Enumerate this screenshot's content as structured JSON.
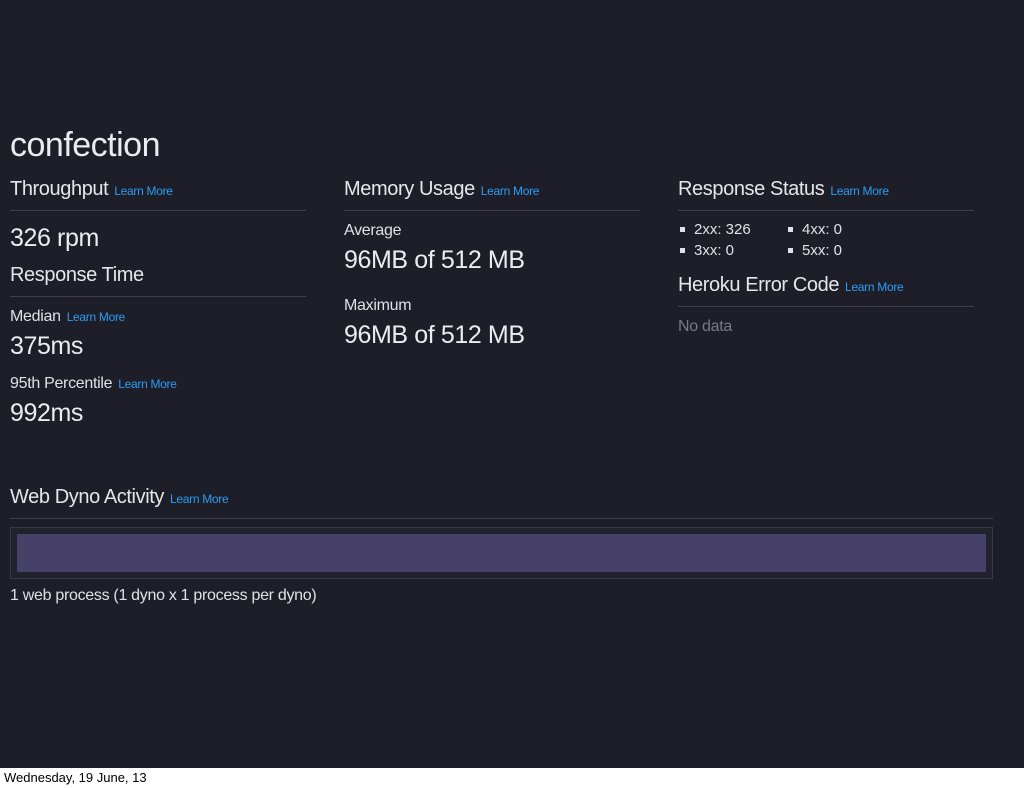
{
  "app": {
    "title": "confection"
  },
  "learn_more": "Learn More",
  "throughput": {
    "title": "Throughput",
    "value": "326 rpm"
  },
  "response_time": {
    "title": "Response Time",
    "median_label": "Median",
    "median_value": "375ms",
    "p95_label": "95th Percentile",
    "p95_value": "992ms"
  },
  "memory": {
    "title": "Memory Usage",
    "average_label": "Average",
    "average_value": "96MB of 512 MB",
    "maximum_label": "Maximum",
    "maximum_value": "96MB of 512 MB"
  },
  "response_status": {
    "title": "Response Status",
    "items": [
      "2xx: 326",
      "4xx: 0",
      "3xx: 0",
      "5xx: 0"
    ]
  },
  "error_code": {
    "title": "Heroku Error Code",
    "empty_text": "No data"
  },
  "dyno": {
    "title": "Web Dyno Activity",
    "activity_fraction": 1.0,
    "bar_color": "#47416a",
    "caption": "1 web process (1 dyno x 1 process per dyno)"
  },
  "colors": {
    "background": "#1e1e28",
    "link": "#2a9df4"
  },
  "footer": {
    "date": "Wednesday, 19 June, 13"
  }
}
